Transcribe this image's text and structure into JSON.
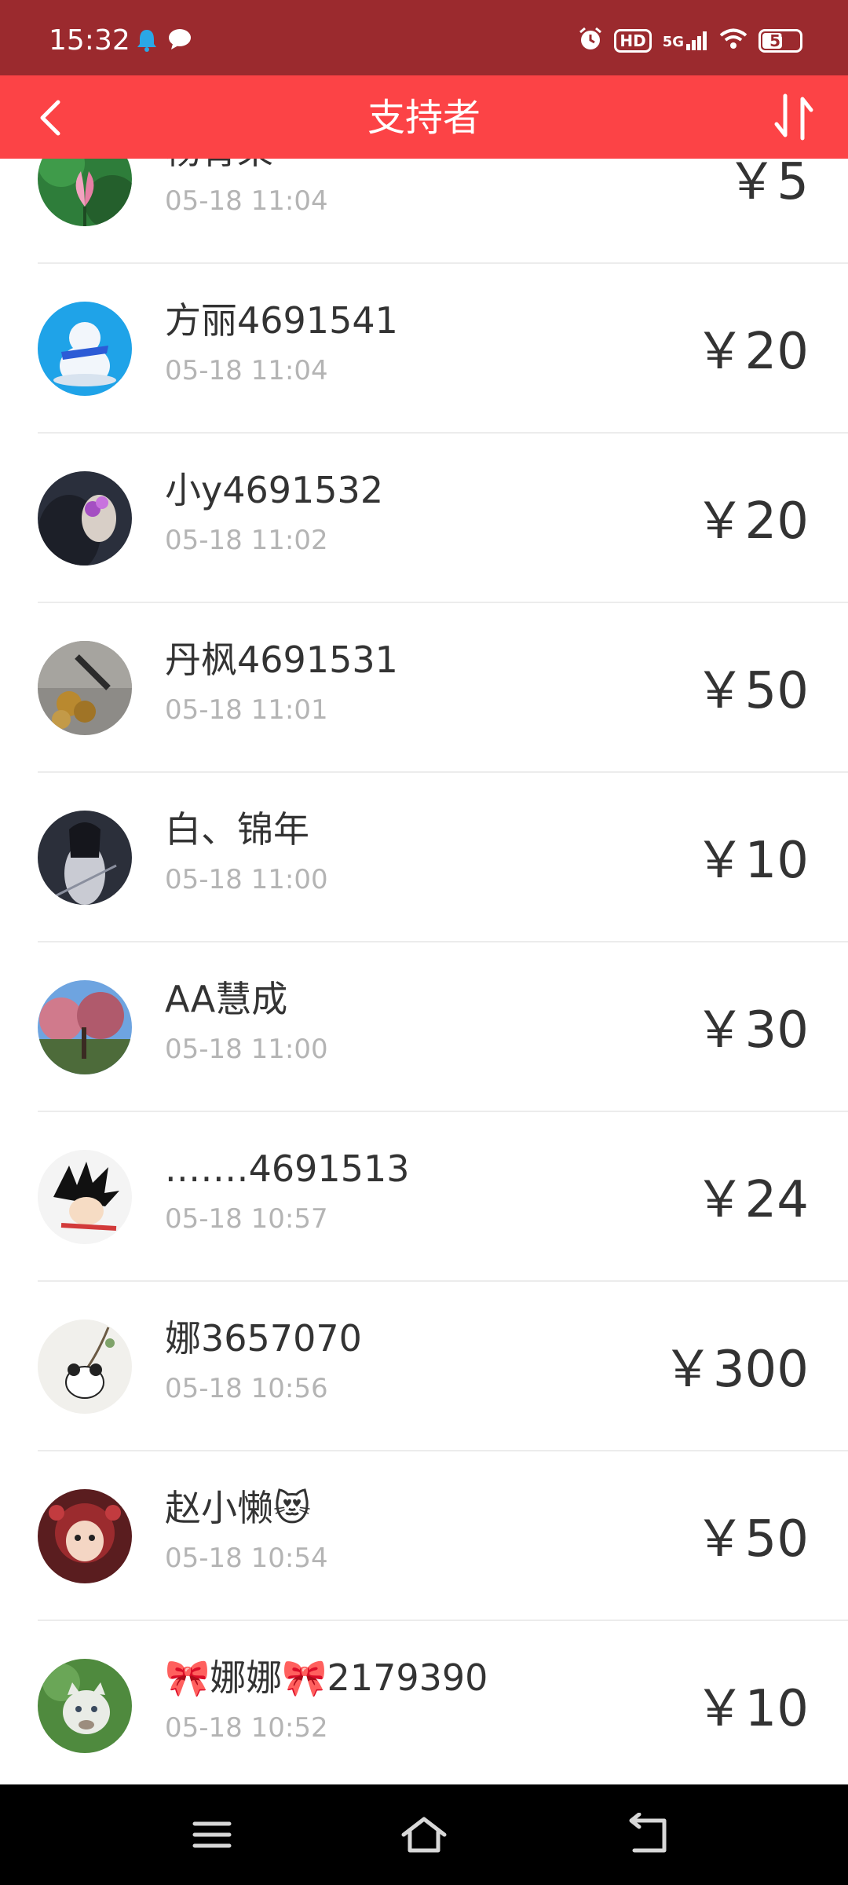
{
  "status_bar": {
    "time": "15:32",
    "left_icons": [
      "notification-bell-icon",
      "chat-bubble-icon"
    ],
    "right_icons": [
      "alarm-icon",
      "hd-icon",
      "signal-5g-icon",
      "wifi-icon",
      "battery-icon"
    ],
    "hd_label": "HD",
    "network_label": "5G",
    "battery_level": "57",
    "battery_fraction": 0.57
  },
  "header": {
    "title": "支持者",
    "back_icon": "chevron-left-icon",
    "sort_icon": "sort-arrows-icon"
  },
  "supporters": [
    {
      "name": "杨青果",
      "time": "05-18 11:04",
      "amount": "￥5"
    },
    {
      "name": "方丽4691541",
      "time": "05-18 11:04",
      "amount": "￥20"
    },
    {
      "name": "小y4691532",
      "time": "05-18 11:02",
      "amount": "￥20"
    },
    {
      "name": "丹枫4691531",
      "time": "05-18 11:01",
      "amount": "￥50"
    },
    {
      "name": "白、锦年",
      "time": "05-18 11:00",
      "amount": "￥10"
    },
    {
      "name": "AA慧成",
      "time": "05-18 11:00",
      "amount": "￥30"
    },
    {
      "name": ".……4691513",
      "time": "05-18 10:57",
      "amount": "￥24"
    },
    {
      "name": "娜3657070",
      "time": "05-18 10:56",
      "amount": "￥300"
    },
    {
      "name": "赵小懒😻",
      "time": "05-18 10:54",
      "amount": "￥50"
    },
    {
      "name": "🎀娜娜🎀2179390",
      "time": "05-18 10:52",
      "amount": "￥10"
    }
  ],
  "system_nav": {
    "icons": [
      "menu-icon",
      "home-icon",
      "back-icon"
    ]
  },
  "colors": {
    "status_bar": "#9b2a2e",
    "header": "#fc4346",
    "text_primary": "#333333",
    "text_secondary": "#b4b4b4",
    "divider": "#ececec"
  }
}
